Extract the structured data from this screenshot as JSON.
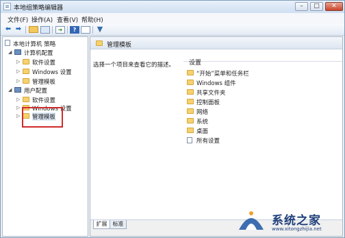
{
  "window": {
    "title": "本地组策略编辑器",
    "controls": [
      "–",
      "□",
      "✕"
    ]
  },
  "menu": [
    "文件(F)",
    "操作(A)",
    "查看(V)",
    "帮助(H)"
  ],
  "toolbar": {
    "icons": [
      "back-arrow-icon",
      "forward-arrow-icon",
      "up-folder-icon",
      "show-tree-icon",
      "export-icon",
      "help-icon",
      "properties-icon",
      "filter-icon"
    ]
  },
  "tree": {
    "root": "本地计算机 策略",
    "computer": {
      "label": "计算机配置",
      "children": [
        "软件设置",
        "Windows 设置",
        "管理模板"
      ]
    },
    "user": {
      "label": "用户配置",
      "children": [
        "软件设置",
        "Windows 设置",
        "管理模板"
      ]
    }
  },
  "right": {
    "header": "管理模板",
    "description": "选择一个项目来查看它的描述。",
    "column": "设置",
    "items": [
      "“开始”菜单和任务栏",
      "Windows 组件",
      "共享文件夹",
      "控制面板",
      "网络",
      "系统",
      "桌面",
      "所有设置"
    ]
  },
  "tabs": [
    "扩展",
    "标准"
  ],
  "watermark": {
    "text": "系统之家",
    "url": "www.xitongzhijia.net"
  },
  "colors": {
    "highlight": "#cf2a2a",
    "accent": "#2a6dba"
  }
}
